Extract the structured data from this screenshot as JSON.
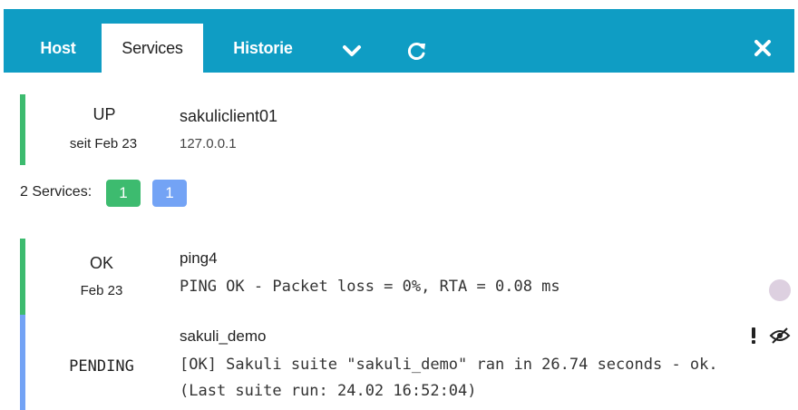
{
  "tabs": [
    {
      "label": "Host"
    },
    {
      "label": "Services"
    },
    {
      "label": "Historie"
    }
  ],
  "icons": {
    "dropdown": "chevron-down-icon",
    "refresh": "refresh-icon",
    "close": "close-icon"
  },
  "colors": {
    "header": "#0f9dc4",
    "ok": "#3dbb6f",
    "pending": "#73a3f5",
    "ack_dot": "#ddd0e0"
  },
  "host": {
    "state": "UP",
    "since": "seit Feb 23",
    "name": "sakuliclient01",
    "address": "127.0.0.1"
  },
  "services_summary": {
    "label": "2 Services:",
    "badges": [
      "1",
      "1"
    ]
  },
  "services": [
    {
      "state": "OK",
      "since": "Feb 23",
      "name": "ping4",
      "output": "PING OK - Packet loss = 0%, RTA = 0.08 ms"
    },
    {
      "state": "PENDING",
      "since": "",
      "name": "sakuli_demo",
      "output_line1": "[OK] Sakuli suite \"sakuli_demo\" ran in 26.74 seconds - ok.",
      "output_line2": "(Last suite run: 24.02 16:52:04)",
      "flags": [
        "exclamation-icon",
        "eye-slash-icon"
      ]
    }
  ]
}
